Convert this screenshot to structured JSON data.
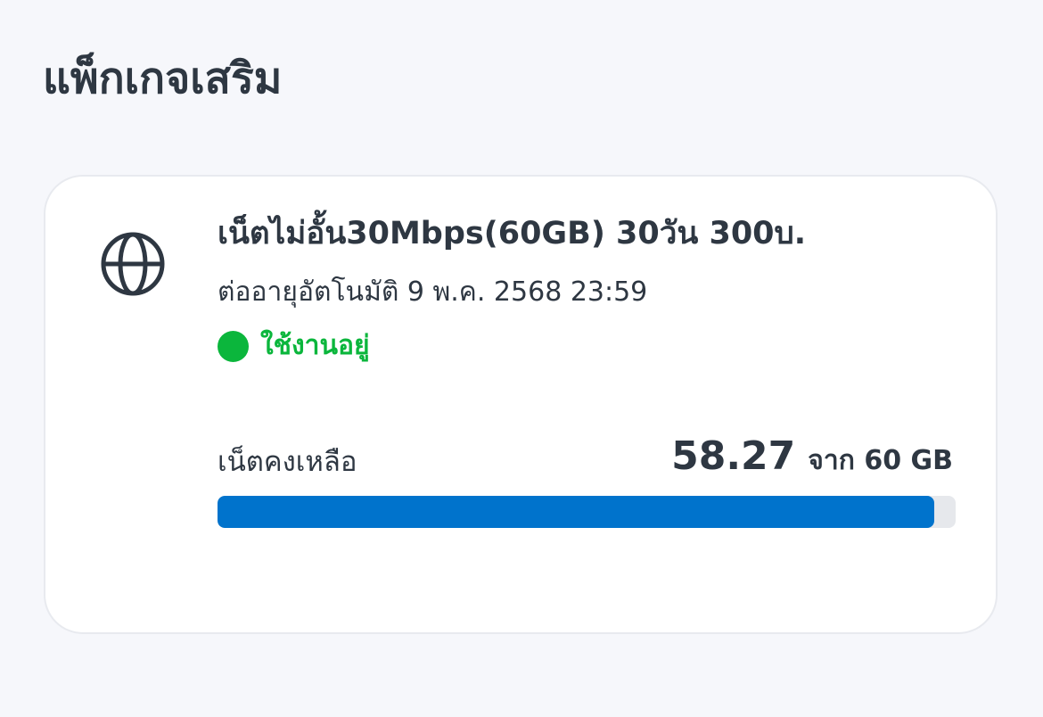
{
  "section": {
    "title": "แพ็กเกจเสริม"
  },
  "package": {
    "icon": "globe-icon",
    "name": "เน็ตไม่อั้น30Mbps(60GB) 30วัน 300บ.",
    "renewal": "ต่ออายุอัตโนมัติ 9 พ.ค. 2568 23:59",
    "status": {
      "label": "ใช้งานอยู่",
      "color": "#0bb63c"
    },
    "data_remaining": {
      "label": "เน็ตคงเหลือ",
      "value": "58.27",
      "of_text": "จาก 60 GB",
      "remaining_gb": 58.27,
      "total_gb": 60
    }
  },
  "colors": {
    "background": "#f6f7fb",
    "text": "#2e3742",
    "accent_bar": "#0073cc",
    "bar_track": "#e6e8ec",
    "status_active": "#0bb63c"
  }
}
